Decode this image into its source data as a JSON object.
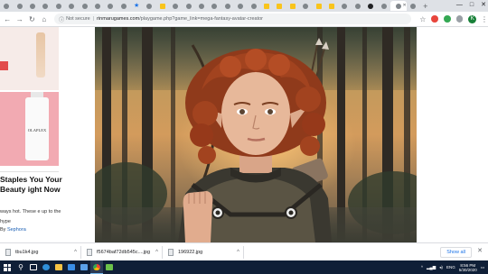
{
  "browser": {
    "tab_count_visible": 32,
    "active_tab_index": 30,
    "new_tab_label": "+",
    "window_controls": [
      "—",
      "□",
      "✕"
    ],
    "nav": {
      "back": "←",
      "forward": "→",
      "reload": "↻",
      "home": "⌂"
    },
    "omnibox": {
      "security_label": "Not secure",
      "separator": "|",
      "host": "rinmarugames.com",
      "path": "/playgame.php?game_link=mega-fantasy-avatar-creator"
    },
    "star": "☆",
    "profile_letter": "K",
    "menu": "⋮"
  },
  "ad": {
    "brand": "OLAPLEX",
    "headline": "Staples You Your Beauty ight Now",
    "body": "ways hot. These e up to the hype",
    "by_label": "By",
    "by_link": "Sephora"
  },
  "downloads": {
    "items": [
      {
        "name": "tbu1k4.jpg"
      },
      {
        "name": "f5674baf72db545c....jpg"
      },
      {
        "name": "196922.jpg"
      }
    ],
    "show_all": "Show all",
    "close": "✕"
  },
  "taskbar": {
    "search_icon": "search-icon",
    "tray_language": "ENG",
    "time": "8:56 PM",
    "date": "5/30/2020"
  },
  "colors": {
    "taskbar_bg": "#0f1f37",
    "tab_strip_bg": "#dee1e6",
    "accent_blue": "#1a73e8",
    "hair": "#a2431f",
    "skin": "#e7b89a"
  }
}
